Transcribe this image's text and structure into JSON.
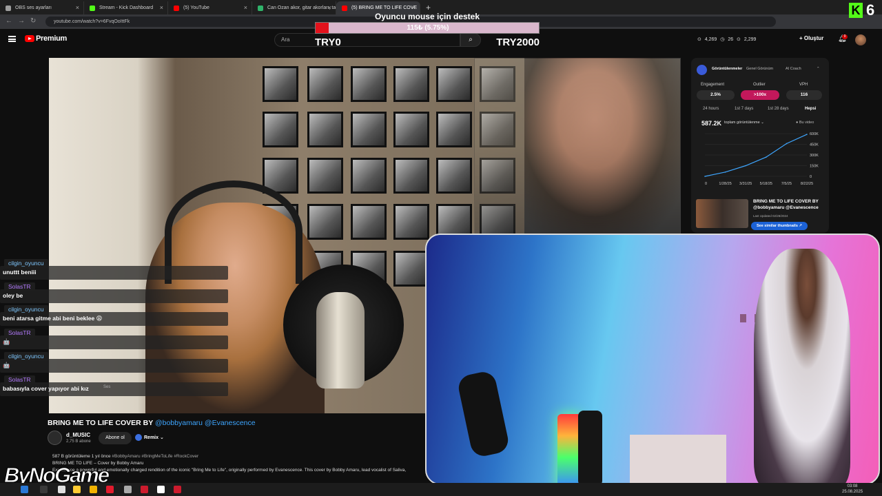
{
  "browser": {
    "tabs": [
      {
        "label": "OBS ses ayarları",
        "color": "#9e9e9e",
        "active": false
      },
      {
        "label": "Stream - Kick Dashboard",
        "color": "#53fc18",
        "active": false
      },
      {
        "label": "(5) YouTube",
        "color": "#ff0000",
        "active": false
      },
      {
        "label": "Can Ozan akor, gitar akorları, ta",
        "color": "#2fb36a",
        "active": false
      },
      {
        "label": "(5) BRING ME TO LIFE COVE",
        "color": "#ff0000",
        "active": true
      }
    ],
    "new_tab": "+",
    "url": "youtube.com/watch?v=6FvqOoIttFk"
  },
  "donation": {
    "title": "Oyuncu mouse için destek",
    "progress_text": "115₺ (5.75%)",
    "progress_fraction": 0.0575,
    "min_label": "TRY0",
    "max_label": "TRY2000",
    "fill_color": "#e3121c"
  },
  "kick": {
    "logo": "K",
    "count": "6"
  },
  "youtube": {
    "brand": "Premium",
    "search_placeholder": "Ara",
    "stats": "⊙ 4,269  ◷ 26  ⊙ 2,299",
    "create_label": "Oluştur",
    "notifications": "9"
  },
  "chat": [
    {
      "user": "cilgin_oyuncu",
      "user_color": "#7fc8ff",
      "message": "unuttt beniii"
    },
    {
      "user": "SolasTR",
      "user_color": "#b47bff",
      "message": "oley be"
    },
    {
      "user": "cilgin_oyuncu",
      "user_color": "#7fc8ff",
      "message": "beni atarsa gitme abi beni beklee 😩"
    },
    {
      "user": "SolasTR",
      "user_color": "#b47bff",
      "message": "🤖"
    },
    {
      "user": "cilgin_oyuncu",
      "user_color": "#7fc8ff",
      "message": "🤖"
    },
    {
      "user": "SolasTR",
      "user_color": "#b47bff",
      "message": "babasıyla cover yapıyor abi kız"
    }
  ],
  "chat_source_label": "Ses",
  "video": {
    "title": "BRING ME TO LIFE COVER BY",
    "title_tags": "@bobbyamaru @Evanescence",
    "channel": "d_MUSIC",
    "subscribers": "2,75 B abone",
    "subscribe_label": "Abone ol",
    "remix_label": "Remix",
    "meta": "587 B görüntüleme  1 yıl önce",
    "meta_tags": "#BobbyAmaru #BringMeToLife #RockCover",
    "desc_line1": "BRING ME TO LIFE – Cover by Bobby Amaru",
    "desc_line2": "Experience a powerful and emotionally charged rendition of the iconic \"Bring Me to Life\", originally performed by Evanescence. This cover by Bobby Amaru, lead vocalist of Saliva,"
  },
  "panel": {
    "tabs": [
      "Görüntülenmeler",
      "Genel Görünüm",
      "AI Coach"
    ],
    "labels": {
      "engagement": "Engagement",
      "outliers": "Outlier",
      "vph": "VPH"
    },
    "values": {
      "engagement": "2.5%",
      "outliers": ">100x",
      "vph": "116"
    },
    "ranges": [
      "24 hours",
      "1st 7 days",
      "1st 28 days",
      "Hepsi"
    ],
    "views_total": "587.2K",
    "views_label": "toplam görüntülenme ⌄",
    "legend": "● Bu video",
    "card_title": "BRING ME TO LIFE COVER BY @bobbyamaru @Evanescence",
    "card_updated": "Last Updated 02/28/2024",
    "similar_btn": "See similar thumbnails ↗"
  },
  "chart_data": {
    "type": "line",
    "x": [
      "0",
      "1/28/25",
      "3/31/25",
      "5/18/25",
      "7/5/25",
      "8/22/25"
    ],
    "series": [
      {
        "values": [
          0,
          60000,
          150000,
          270000,
          460000,
          590000
        ]
      }
    ],
    "yticks": [
      "600K",
      "450K",
      "300K",
      "150K",
      "0"
    ],
    "ylim": [
      0,
      600000
    ],
    "color": "#3ea6ff"
  },
  "watermark": "ByNoGame",
  "clock": {
    "time": "03:08",
    "date": "25.08.2025"
  }
}
